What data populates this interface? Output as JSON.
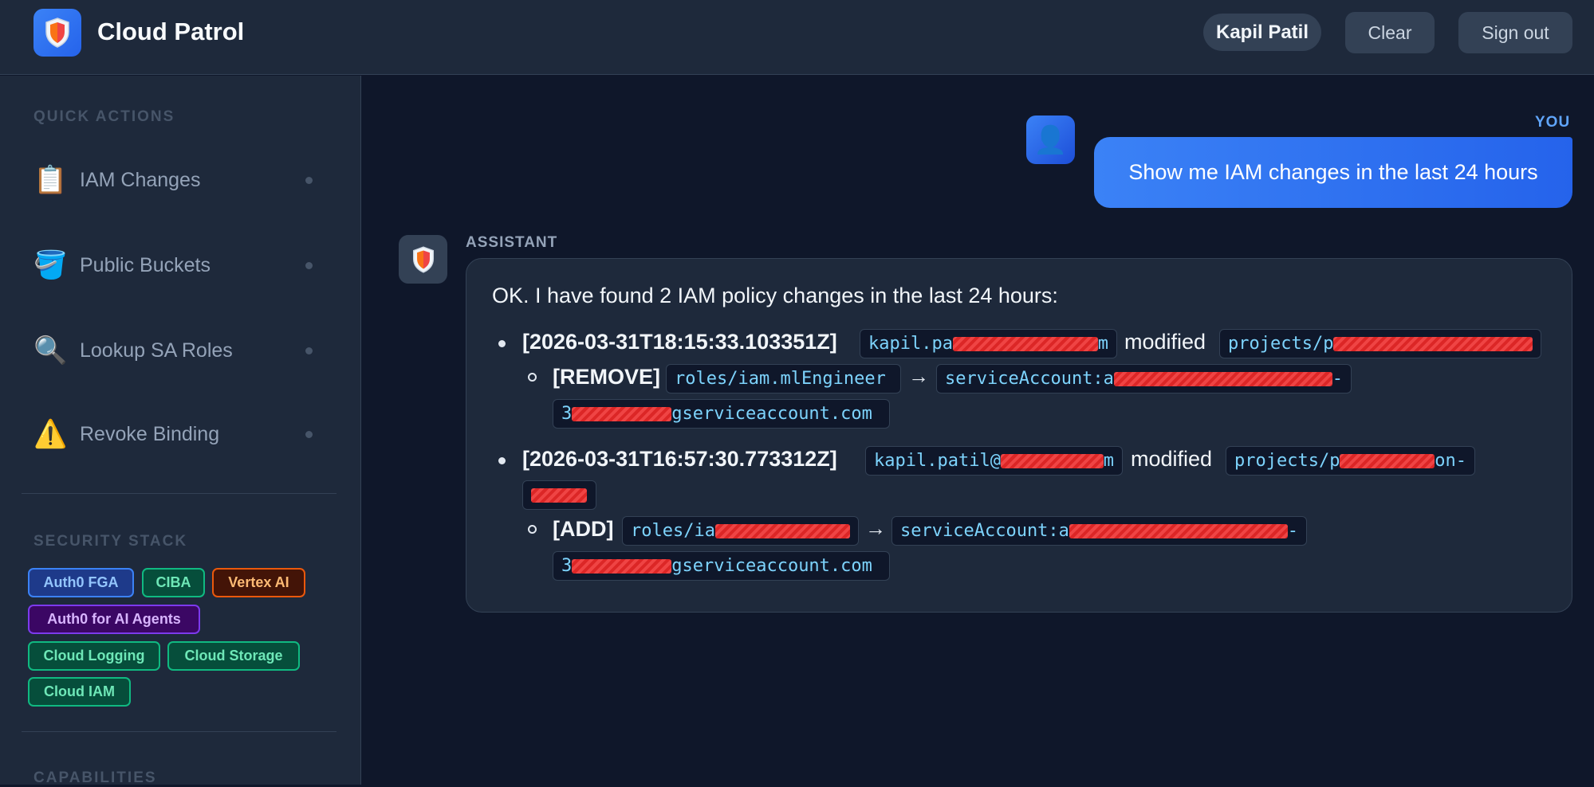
{
  "header": {
    "title": "Cloud Patrol",
    "logo_icon": "shield-icon",
    "user_name": "Kapil Patil",
    "clear_label": "Clear",
    "signout_label": "Sign out"
  },
  "sidebar": {
    "quick_actions_title": "QUICK ACTIONS",
    "quick_actions": [
      {
        "label": "IAM Changes",
        "icon": "clipboard-icon"
      },
      {
        "label": "Public Buckets",
        "icon": "bucket-icon"
      },
      {
        "label": "Lookup SA Roles",
        "icon": "magnifier-icon"
      },
      {
        "label": "Revoke Binding",
        "icon": "warning-icon"
      }
    ],
    "security_stack_title": "SECURITY STACK",
    "security_stack": [
      {
        "label": "Auth0 FGA",
        "color": "#3b82f6"
      },
      {
        "label": "CIBA",
        "color": "#10b981"
      },
      {
        "label": "Vertex AI",
        "color": "#ea580c"
      },
      {
        "label": "Auth0 for AI Agents",
        "color": "#7c3aed"
      },
      {
        "label": "Cloud Logging",
        "color": "#10b981"
      },
      {
        "label": "Cloud Storage",
        "color": "#10b981"
      },
      {
        "label": "Cloud IAM",
        "color": "#10b981"
      }
    ],
    "capabilities_title": "CAPABILITIES"
  },
  "chat": {
    "user_label": "YOU",
    "user_message": "Show me IAM changes in the last 24 hours",
    "assistant_label": "ASSISTANT",
    "assistant_intro": "OK. I have found 2 IAM policy changes in the last 24 hours:",
    "changes": [
      {
        "timestamp": "[2026-03-31T18:15:33.103351Z]",
        "actor": "kapil.pa",
        "actor_tail": "m",
        "verb": "modified",
        "project": "projects/p",
        "action": "[REMOVE]",
        "role": "roles/iam.mlEngineer",
        "arrow": "→",
        "member": "serviceAccount:a",
        "member_tail": "-",
        "member_line2_head": "3",
        "member_line2": "gserviceaccount.com"
      },
      {
        "timestamp": "[2026-03-31T16:57:30.773312Z]",
        "actor": "kapil.patil@",
        "actor_tail": "m",
        "verb": "modified",
        "project": "projects/p",
        "project_tail": "on-",
        "action": "[ADD]",
        "role": "roles/ia",
        "arrow": "→",
        "member": "serviceAccount:a",
        "member_tail": "-",
        "member_line2_head": "3",
        "member_line2": "gserviceaccount.com"
      }
    ]
  }
}
